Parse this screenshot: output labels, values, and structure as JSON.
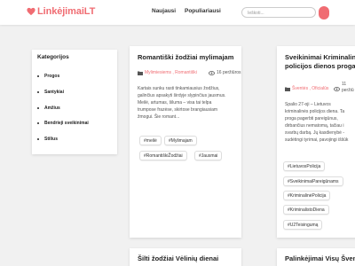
{
  "header": {
    "logo_text": "LinkėjimaiLT",
    "nav": [
      "Naujausi",
      "Populiariausi"
    ],
    "search_placeholder": "Ieškoti..."
  },
  "sidebar": {
    "title": "Kategorijos",
    "items": [
      "Progos",
      "Santykiai",
      "Amžius",
      "Bendrieji sveikinimai",
      "Stilius"
    ]
  },
  "cards": [
    {
      "title": "Romantiški žodžiai mylimajam",
      "categories": "Mylimiesiems , Romantiški",
      "views": "16 peržiūros",
      "excerpt": [
        "Kartais sunku rasti tinkamiausius žodžius,",
        "galinčius apsakyti širdyje slypinčius jausmus.",
        "Meilė, artumas, šiluma – visa tai telpa",
        "trumpose frazėse, skirtose brangiausiam",
        "žmogui. Šie romant..."
      ],
      "tags": [
        "#meilė",
        "#Mylimajam",
        "#RomantiškiŽodžiai",
        "#Jausmai"
      ]
    },
    {
      "title_lines": [
        "Sveikinimai Kriminalinė",
        "policijos dienos proga"
      ],
      "categories": "Šventės , Oficialūs",
      "views": "11 peržiū",
      "excerpt": [
        "Spalio 27-oji – Lietuvos",
        "kriminalinės policijos diena. Ta",
        "proga pagerbti pareigūnus,",
        "dirbančius nematomą, tačiau i",
        "svarbų darbą. Jų kasdienybė -",
        "sudėtingi tyrimai, pavojingi iššūk"
      ],
      "tags": [
        "#LietuvosPolicija",
        "#SveikinimaiPareigūnams",
        "#KriminalinėPolicija",
        "#KriminalistoDiena",
        "#U2Teisingumą"
      ]
    },
    {
      "title": "Šilti žodžiai Vėlinių dienai"
    },
    {
      "title": "Palinkėjimai Visų Šventų"
    }
  ],
  "colors": {
    "accent": "#f06c72",
    "background": "#f1f1f1"
  }
}
